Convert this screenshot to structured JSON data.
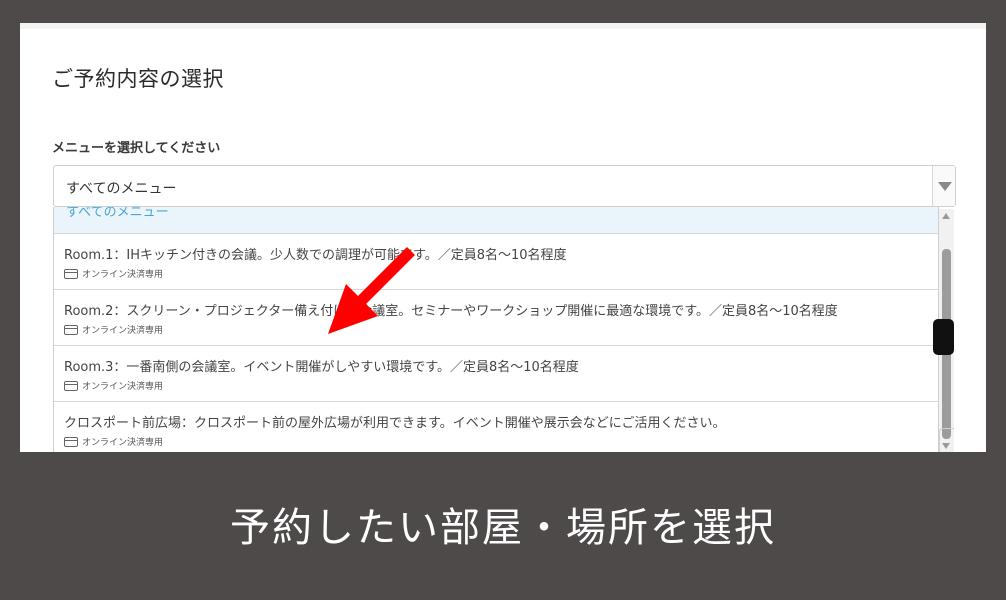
{
  "page_title": "ご予約内容の選択",
  "menu_label": "メニューを選択してください",
  "select": {
    "value": "すべてのメニュー"
  },
  "options": [
    {
      "label": "すべてのメニュー"
    },
    {
      "label": "Room.1：IHキッチン付きの会議。少人数での調理が可能です。／定員8名～10名程度",
      "badge": "オンライン決済専用"
    },
    {
      "label": "Room.2：スクリーン・プロジェクター備え付けの会議室。セミナーやワークショップ開催に最適な環境です。／定員8名～10名程度",
      "badge": "オンライン決済専用"
    },
    {
      "label": "Room.3：一番南側の会議室。イベント開催がしやすい環境です。／定員8名～10名程度",
      "badge": "オンライン決済専用"
    },
    {
      "label": "クロスポート前広場：クロスポート前の屋外広場が利用できます。イベント開催や展示会などにご活用ください。",
      "badge": "オンライン決済専用"
    }
  ],
  "caption": "予約したい部屋・場所を選択",
  "colors": {
    "background": "#4e4a4a",
    "arrow": "#ff0000",
    "highlight": "#eaf4fb",
    "accent_text": "#4aa6d6"
  },
  "icons": [
    "card-icon",
    "dropdown-arrow-icon",
    "red-pointer-arrow"
  ]
}
